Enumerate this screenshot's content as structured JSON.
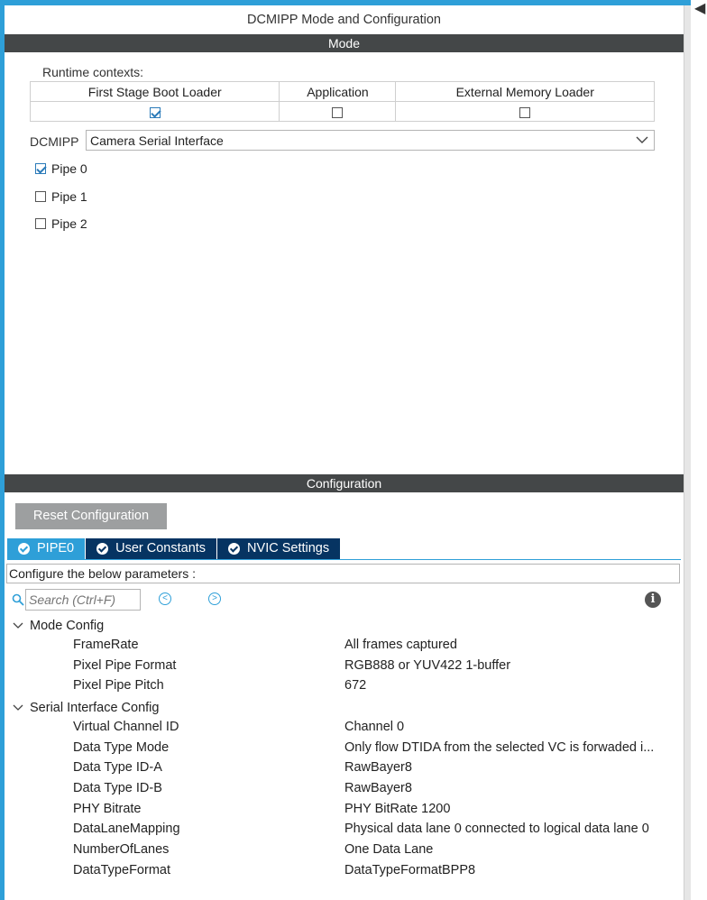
{
  "window": {
    "title": "DCMIPP Mode and Configuration"
  },
  "mode_section": {
    "header": "Mode",
    "runtime_contexts_label": "Runtime contexts:",
    "contexts": [
      {
        "label": "First Stage Boot Loader",
        "checked": true
      },
      {
        "label": "Application",
        "checked": false
      },
      {
        "label": "External Memory Loader",
        "checked": false
      }
    ],
    "dcmipp_label": "DCMIPP",
    "dcmipp_value": "Camera Serial Interface",
    "pipes": [
      {
        "label": "Pipe 0",
        "checked": true
      },
      {
        "label": "Pipe 1",
        "checked": false
      },
      {
        "label": "Pipe 2",
        "checked": false
      }
    ]
  },
  "config_section": {
    "header": "Configuration",
    "reset_button": "Reset Configuration",
    "tabs": [
      {
        "label": "PIPE0",
        "active": true
      },
      {
        "label": "User Constants",
        "active": false
      },
      {
        "label": "NVIC Settings",
        "active": false
      }
    ],
    "params_hint": "Configure the below parameters :",
    "search_placeholder": "Search (Ctrl+F)",
    "groups": [
      {
        "label": "Mode Config",
        "params": [
          {
            "name": "FrameRate",
            "value": "All frames captured"
          },
          {
            "name": "Pixel Pipe Format",
            "value": "RGB888 or YUV422 1-buffer"
          },
          {
            "name": "Pixel Pipe Pitch",
            "value": "672"
          }
        ]
      },
      {
        "label": "Serial Interface Config",
        "params": [
          {
            "name": "Virtual Channel ID",
            "value": "Channel 0"
          },
          {
            "name": "Data Type Mode",
            "value": "Only flow DTIDA from the selected VC is forwaded i..."
          },
          {
            "name": "Data Type ID-A",
            "value": "RawBayer8"
          },
          {
            "name": "Data Type ID-B",
            "value": "RawBayer8"
          },
          {
            "name": "PHY Bitrate",
            "value": "PHY BitRate 1200"
          },
          {
            "name": "DataLaneMapping",
            "value": "Physical data lane 0 connected to logical data lane 0"
          },
          {
            "name": "NumberOfLanes",
            "value": "One Data Lane"
          },
          {
            "name": "DataTypeFormat",
            "value": "DataTypeFormatBPP8"
          }
        ]
      }
    ]
  },
  "colors": {
    "accent": "#2e9fd8",
    "dark_tab": "#063462",
    "section_bar": "#444748",
    "button_gray": "#9d9fa0"
  }
}
